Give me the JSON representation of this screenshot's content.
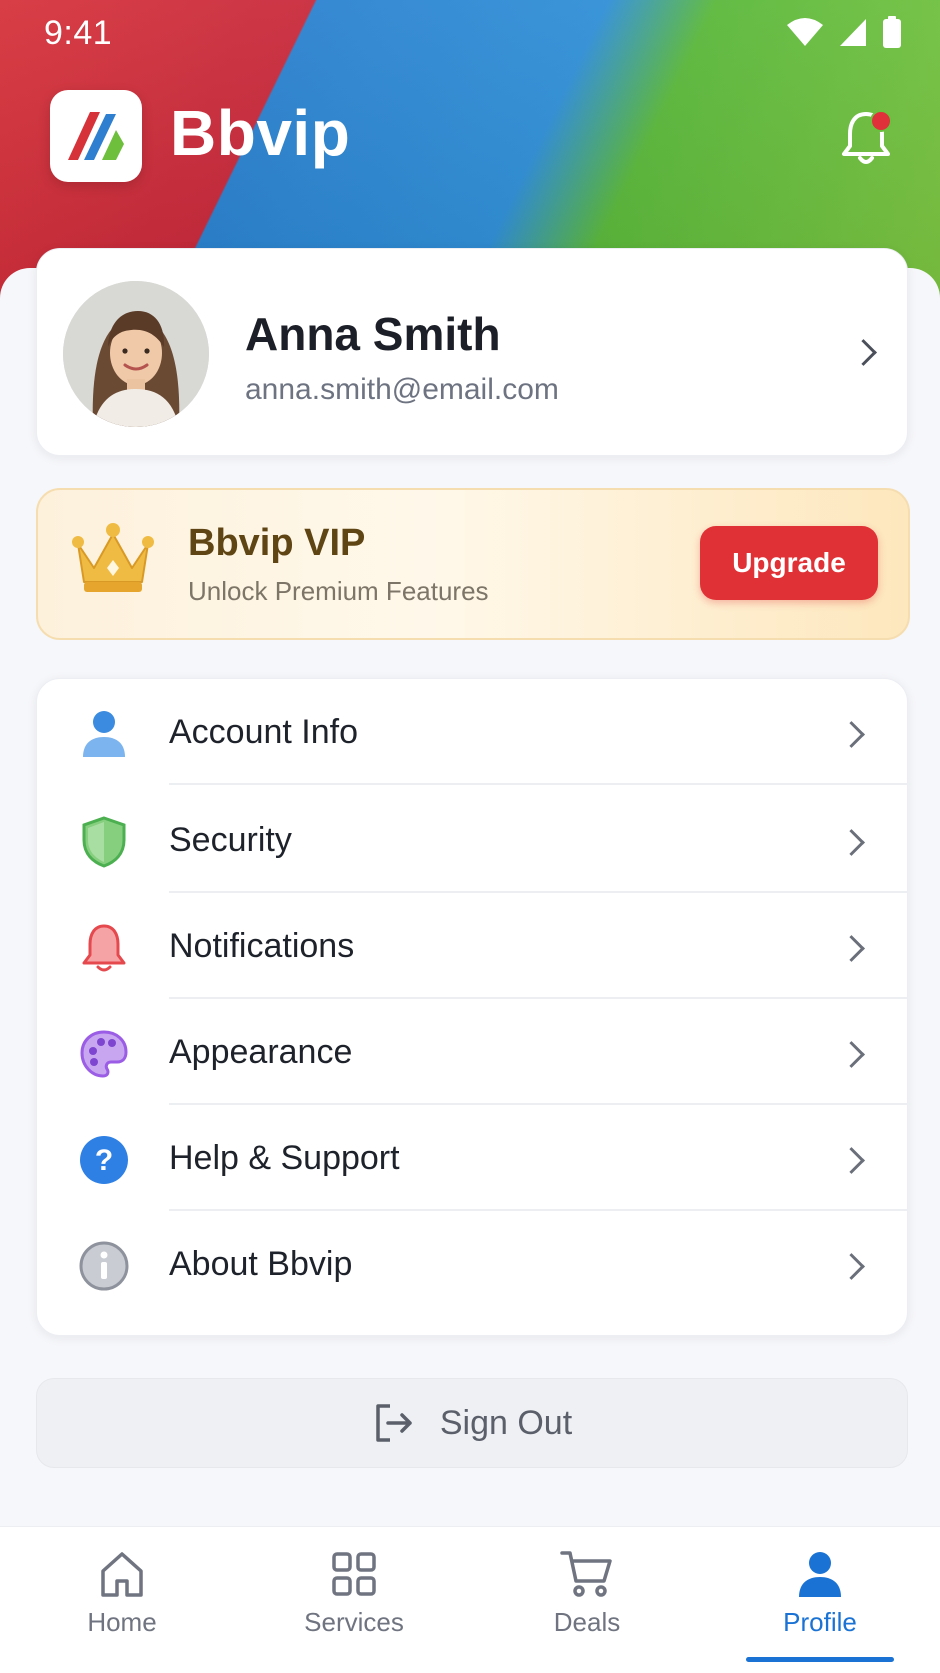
{
  "status_bar": {
    "time": "9:41"
  },
  "header": {
    "app_title": "Bbvip"
  },
  "profile": {
    "name": "Anna Smith",
    "email": "anna.smith@email.com"
  },
  "vip": {
    "title": "Bbvip VIP",
    "subtitle": "Unlock Premium Features",
    "button_label": "Upgrade"
  },
  "menu": {
    "items": [
      {
        "label": "Account Info",
        "icon": "person-icon",
        "color": "#3b8be0"
      },
      {
        "label": "Security",
        "icon": "shield-icon",
        "color": "#4caf50"
      },
      {
        "label": "Notifications",
        "icon": "bell-icon",
        "color": "#e5484d"
      },
      {
        "label": "Appearance",
        "icon": "palette-icon",
        "color": "#9b5de5"
      },
      {
        "label": "Help & Support",
        "icon": "help-icon",
        "color": "#2f80e4"
      },
      {
        "label": "About Bbvip",
        "icon": "info-icon",
        "color": "#8d929c"
      }
    ]
  },
  "sign_out": {
    "label": "Sign Out"
  },
  "bottom_nav": {
    "items": [
      {
        "label": "Home",
        "icon": "home-icon"
      },
      {
        "label": "Services",
        "icon": "grid-icon"
      },
      {
        "label": "Deals",
        "icon": "cart-icon"
      },
      {
        "label": "Profile",
        "icon": "person-icon",
        "active": true
      }
    ]
  },
  "colors": {
    "accent": "#1a73d4",
    "upgrade": "#e03236",
    "brand_red": "#d6323a",
    "brand_blue": "#2f8ed6",
    "brand_green": "#7cc441"
  }
}
